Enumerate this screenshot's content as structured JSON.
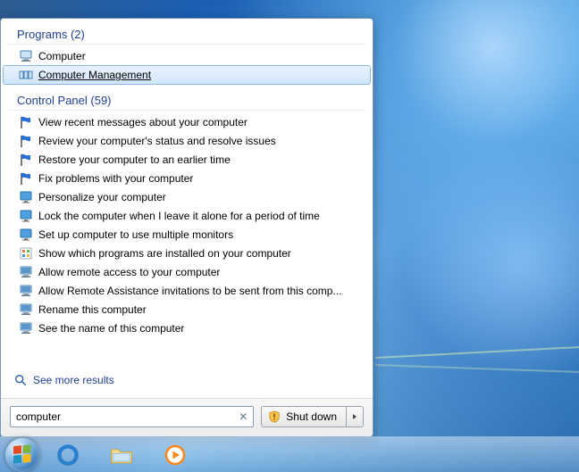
{
  "programs_header": "Programs (2)",
  "programs": [
    {
      "label": "Computer",
      "icon": "computer"
    },
    {
      "label": "Computer Management",
      "icon": "mgmt",
      "selected": true
    }
  ],
  "control_panel_header": "Control Panel (59)",
  "control_panel": [
    {
      "label": "View recent messages about your computer",
      "icon": "flag"
    },
    {
      "label": "Review your computer's status and resolve issues",
      "icon": "flag"
    },
    {
      "label": "Restore your computer to an earlier time",
      "icon": "flag"
    },
    {
      "label": "Fix problems with your computer",
      "icon": "flag"
    },
    {
      "label": "Personalize your computer",
      "icon": "monitor"
    },
    {
      "label": "Lock the computer when I leave it alone for a period of time",
      "icon": "monitor"
    },
    {
      "label": "Set up computer to use multiple monitors",
      "icon": "monitor"
    },
    {
      "label": "Show which programs are installed on your computer",
      "icon": "programs"
    },
    {
      "label": "Allow remote access to your computer",
      "icon": "sys"
    },
    {
      "label": "Allow Remote Assistance invitations to be sent from this comp...",
      "icon": "sys"
    },
    {
      "label": "Rename this computer",
      "icon": "sys"
    },
    {
      "label": "See the name of this computer",
      "icon": "sys"
    }
  ],
  "see_more": "See more results",
  "search_value": "computer",
  "shutdown_label": "Shut down"
}
